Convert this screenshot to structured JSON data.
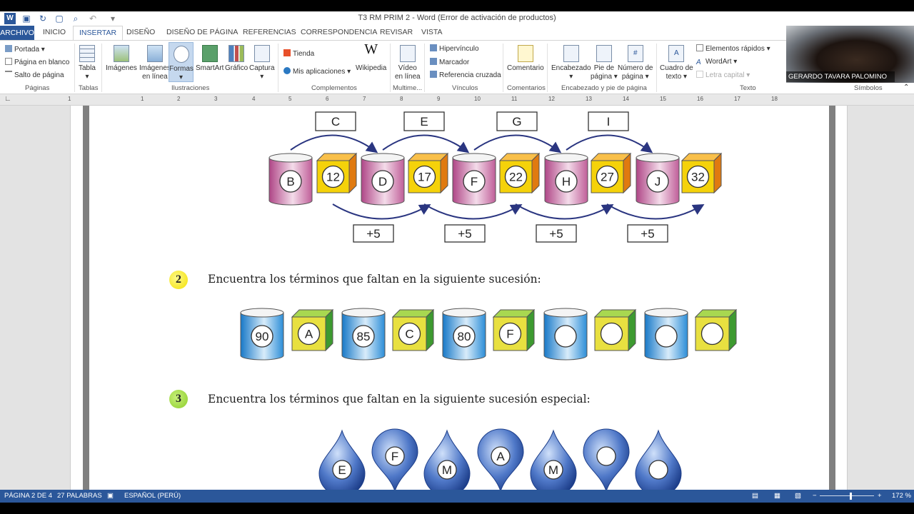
{
  "window": {
    "title": "T3 RM PRIM 2 - Word (Error de activación de productos)"
  },
  "tabs": [
    "ARCHIVO",
    "INICIO",
    "INSERTAR",
    "DISEÑO",
    "DISEÑO DE PÁGINA",
    "REFERENCIAS",
    "CORRESPONDENCIA",
    "REVISAR",
    "VISTA"
  ],
  "ribbon": {
    "paginas": {
      "label": "Páginas",
      "portada": "Portada",
      "blanco": "Página en blanco",
      "salto": "Salto de página"
    },
    "tablas": {
      "label": "Tablas",
      "tabla": "Tabla"
    },
    "ilustraciones": {
      "label": "Ilustraciones",
      "imagenes": "Imágenes",
      "imagenes_linea_1": "Imágenes",
      "imagenes_linea_2": "en línea",
      "formas": "Formas",
      "smartart": "SmartArt",
      "grafico": "Gráfico",
      "captura": "Captura"
    },
    "complementos": {
      "label": "Complementos",
      "tienda": "Tienda",
      "mis_aplicaciones": "Mis aplicaciones",
      "wikipedia": "Wikipedia"
    },
    "multimedia": {
      "label": "Multime...",
      "video_1": "Vídeo",
      "video_2": "en línea"
    },
    "vinculos": {
      "label": "Vínculos",
      "hipervinculo": "Hipervínculo",
      "marcador": "Marcador",
      "referencia": "Referencia cruzada"
    },
    "comentarios": {
      "label": "Comentarios",
      "comentario": "Comentario"
    },
    "encabezado": {
      "label": "Encabezado y pie de página",
      "encabezado": "Encabezado",
      "pie_1": "Pie de",
      "pie_2": "página",
      "numero_1": "Número de",
      "numero_2": "página"
    },
    "texto": {
      "label": "Texto",
      "cuadro_1": "Cuadro de",
      "cuadro_2": "texto",
      "elementos": "Elementos rápidos",
      "wordart": "WordArt",
      "letra": "Letra capital"
    },
    "simbolos": {
      "label": "Símbolos"
    }
  },
  "ruler": [
    "1",
    "1",
    "2",
    "3",
    "4",
    "5",
    "6",
    "7",
    "8",
    "9",
    "10",
    "11",
    "12",
    "13",
    "14",
    "15",
    "16",
    "17",
    "18"
  ],
  "document": {
    "top_letters": [
      "C",
      "E",
      "G",
      "I"
    ],
    "top_row": [
      "B",
      "12",
      "D",
      "17",
      "F",
      "22",
      "H",
      "27",
      "J",
      "32"
    ],
    "increments": [
      "+5",
      "+5",
      "+5",
      "+5"
    ],
    "q2": {
      "number": "2",
      "text": "Encuentra los términos que faltan en la siguiente sucesión:",
      "items": [
        "90",
        "A",
        "85",
        "C",
        "80",
        "F",
        "",
        "",
        "",
        ""
      ]
    },
    "q3": {
      "number": "3",
      "text": "Encuentra los términos que faltan en la siguiente sucesión especial:",
      "drops": [
        "E",
        "F",
        "M",
        "A",
        "M",
        "",
        ""
      ]
    }
  },
  "status": {
    "page": "PÁGINA 2 DE 4",
    "words": "27 PALABRAS",
    "lang": "ESPAÑOL (PERÚ)",
    "zoom": "172 %"
  },
  "webcam": {
    "name": "GERARDO TAVARA PALOMINO"
  },
  "colors": {
    "word_blue": "#2b579a",
    "pink": "#c0609a",
    "orange": "#f0a020",
    "yellow": "#f5d20a",
    "blue": "#2f8fd8",
    "green": "#4caa3a",
    "navy": "#2a3580"
  }
}
